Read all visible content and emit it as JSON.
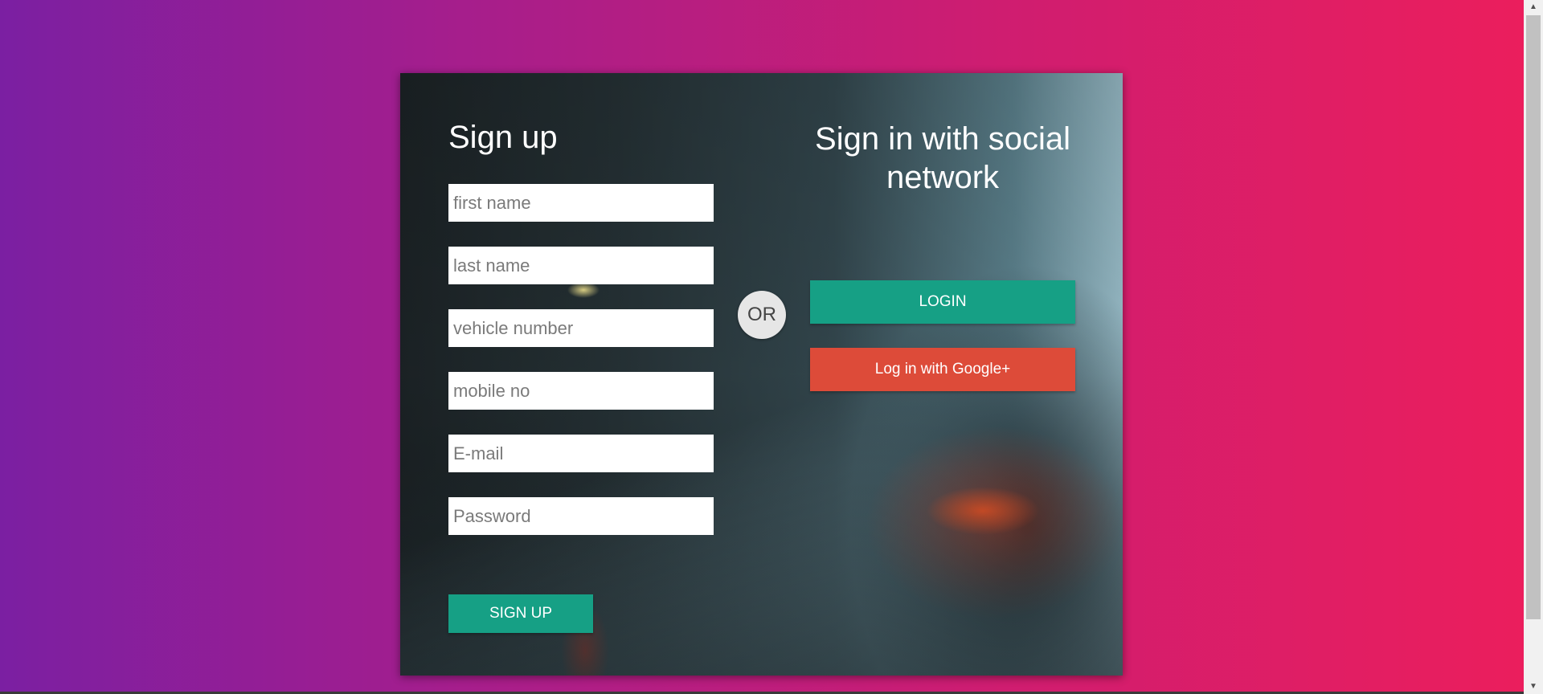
{
  "signup": {
    "title": "Sign up",
    "fields": {
      "first_name": "first name",
      "last_name": "last name",
      "vehicle_number": "vehicle number",
      "mobile_no": "mobile no",
      "email": "E-mail",
      "password": "Password"
    },
    "submit_label": "SIGN UP"
  },
  "divider": {
    "label": "OR"
  },
  "social": {
    "title": "Sign in with social network",
    "login_label": "LOGIN",
    "google_label": "Log in with Google+"
  },
  "colors": {
    "background_start": "#7b1fa2",
    "background_end": "#ec1e5c",
    "primary_button": "#16a085",
    "google_button": "#dd4b39",
    "or_circle": "#e6e6e6"
  },
  "icons": {
    "scroll_up": "scroll-up-arrow-icon",
    "scroll_down": "scroll-down-arrow-icon"
  }
}
